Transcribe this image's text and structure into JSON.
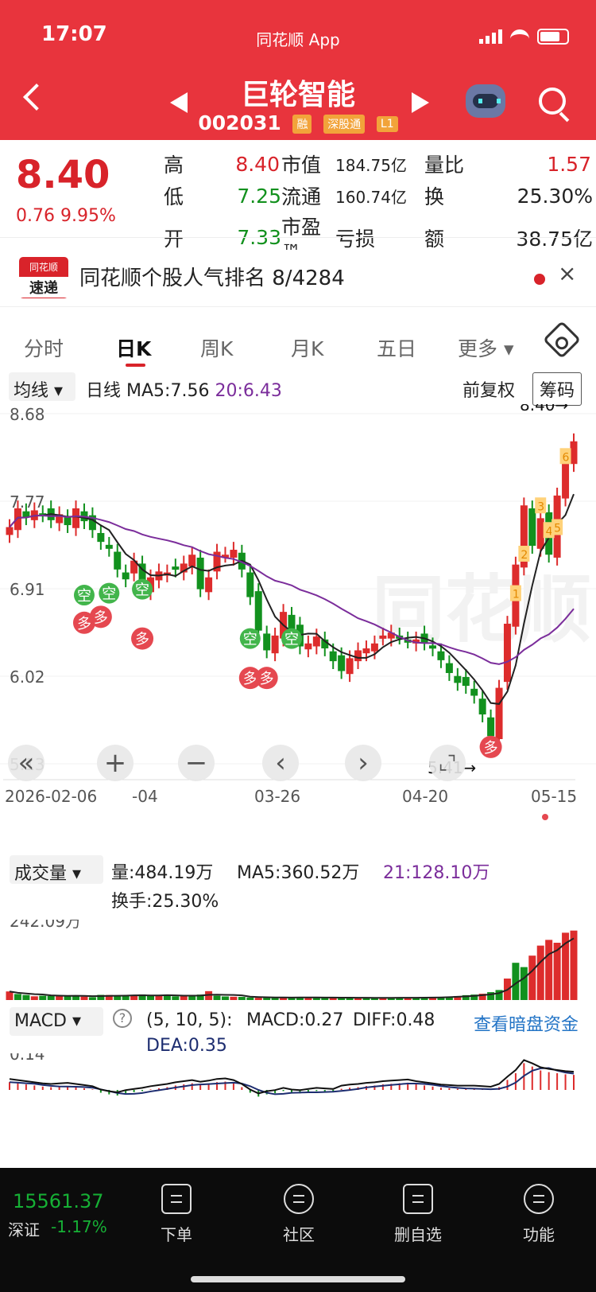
{
  "status": {
    "time": "17:07",
    "app": "同花顺 App"
  },
  "stock": {
    "name": "巨轮智能",
    "code": "002031",
    "badges": [
      "融",
      "深股通",
      "L1"
    ]
  },
  "quote": {
    "price": "8.40",
    "change": "0.76",
    "change_pct": "9.95%",
    "rows": [
      [
        "高",
        "8.40",
        "市值",
        "184.75亿",
        "量比",
        "1.57"
      ],
      [
        "低",
        "7.25",
        "流通",
        "160.74亿",
        "换",
        "25.30%"
      ],
      [
        "开",
        "7.33",
        "市盈™",
        "亏损",
        "额",
        "38.75亿"
      ]
    ]
  },
  "rank": {
    "logo_top": "同花顺",
    "logo_bottom": "速递",
    "text": "同花顺个股人气排名 8/4284"
  },
  "tabs": [
    "分时",
    "日K",
    "周K",
    "月K",
    "五日",
    "更多"
  ],
  "indicators": {
    "ma_type": "均线",
    "daily": "日线",
    "ma5": "MA5:7.56",
    "ma20": "20:6.43",
    "adjust": "前复权",
    "chip": "筹码"
  },
  "chart_data": {
    "type": "candlestick",
    "title": "巨轮智能",
    "ylim": [
      5.13,
      8.68
    ],
    "y_ticks": [
      "8.68",
      "7.77",
      "6.91",
      "6.02",
      "5.13"
    ],
    "x_labels": [
      "2026-02-06",
      "-04",
      "03-26",
      "04-20",
      "05-15"
    ],
    "annotations": [
      "8.40→",
      "5.41→",
      "空",
      "多",
      "1",
      "2",
      "3",
      "4",
      "5",
      "6"
    ],
    "series": [
      {
        "name": "K线",
        "values": [
          7.53,
          7.72,
          7.63,
          7.7,
          7.66,
          7.6,
          7.66,
          7.55,
          7.72,
          7.59,
          7.5,
          7.38,
          7.31,
          7.1,
          7.0,
          7.19,
          6.9,
          7.02,
          7.08,
          7.07,
          7.1,
          7.16,
          7.25,
          6.9,
          7.02,
          7.28,
          7.25,
          7.3,
          7.1,
          6.82,
          6.48,
          6.28,
          6.43,
          6.67,
          6.48,
          6.32,
          6.35,
          6.42,
          6.3,
          6.17,
          6.07,
          6.2,
          6.28,
          6.3,
          6.35,
          6.43,
          6.46,
          6.42,
          6.38,
          6.39,
          6.36,
          6.3,
          6.18,
          6.05,
          5.95,
          5.92,
          5.82,
          5.63,
          5.41,
          5.9,
          6.55,
          7.15,
          7.75,
          7.34,
          7.62,
          7.25,
          7.85,
          8.2,
          8.4
        ]
      }
    ],
    "volume": {
      "title": "成交量",
      "value": "量:484.19万",
      "ma5": "MA5:360.52万",
      "ma21": "21:128.10万",
      "turnover": "换手:25.30%",
      "ylabel": "242.09万",
      "values": [
        60,
        42,
        35,
        26,
        30,
        29,
        33,
        28,
        31,
        24,
        20,
        36,
        35,
        33,
        29,
        31,
        39,
        28,
        34,
        37,
        26,
        29,
        27,
        38,
        62,
        30,
        25,
        23,
        22,
        18,
        16,
        17,
        18,
        20,
        16,
        18,
        18,
        17,
        18,
        16,
        16,
        16,
        15,
        16,
        15,
        15,
        16,
        17,
        17,
        15,
        18,
        20,
        22,
        25,
        28,
        34,
        38,
        44,
        55,
        70,
        150,
        260,
        230,
        310,
        380,
        420,
        400,
        470,
        485
      ]
    },
    "macd": {
      "title": "MACD",
      "params": "(5, 10, 5):",
      "macd": "MACD:0.27",
      "diff": "DIFF:0.48",
      "dea": "DEA:0.35",
      "link": "查看暗盘资金",
      "ylabel": "0.14",
      "values": [
        0.14,
        0.12,
        0.1,
        0.08,
        0.06,
        0.05,
        0.06,
        0.07,
        0.05,
        0.03,
        0.01,
        -0.05,
        -0.08,
        -0.1,
        -0.06,
        -0.04,
        -0.02,
        0.01,
        0.03,
        0.05,
        0.08,
        0.1,
        0.12,
        0.09,
        0.11,
        0.14,
        0.15,
        0.12,
        0.05,
        -0.05,
        -0.12,
        -0.08,
        -0.06,
        -0.02,
        -0.05,
        -0.06,
        -0.04,
        -0.02,
        -0.03,
        -0.04,
        0.02,
        0.04,
        0.05,
        0.07,
        0.08,
        0.1,
        0.11,
        0.12,
        0.13,
        0.1,
        0.08,
        0.06,
        0.04,
        0.03,
        0.02,
        0.02,
        0.02,
        0.01,
        0.0,
        0.05,
        0.18,
        0.3,
        0.48,
        0.42,
        0.35,
        0.32,
        0.3,
        0.28,
        0.27
      ]
    }
  },
  "bottom": {
    "market": "深证",
    "index": "15561.37",
    "index_change": "-1.17%",
    "items": [
      "下单",
      "社区",
      "删自选",
      "功能"
    ]
  }
}
